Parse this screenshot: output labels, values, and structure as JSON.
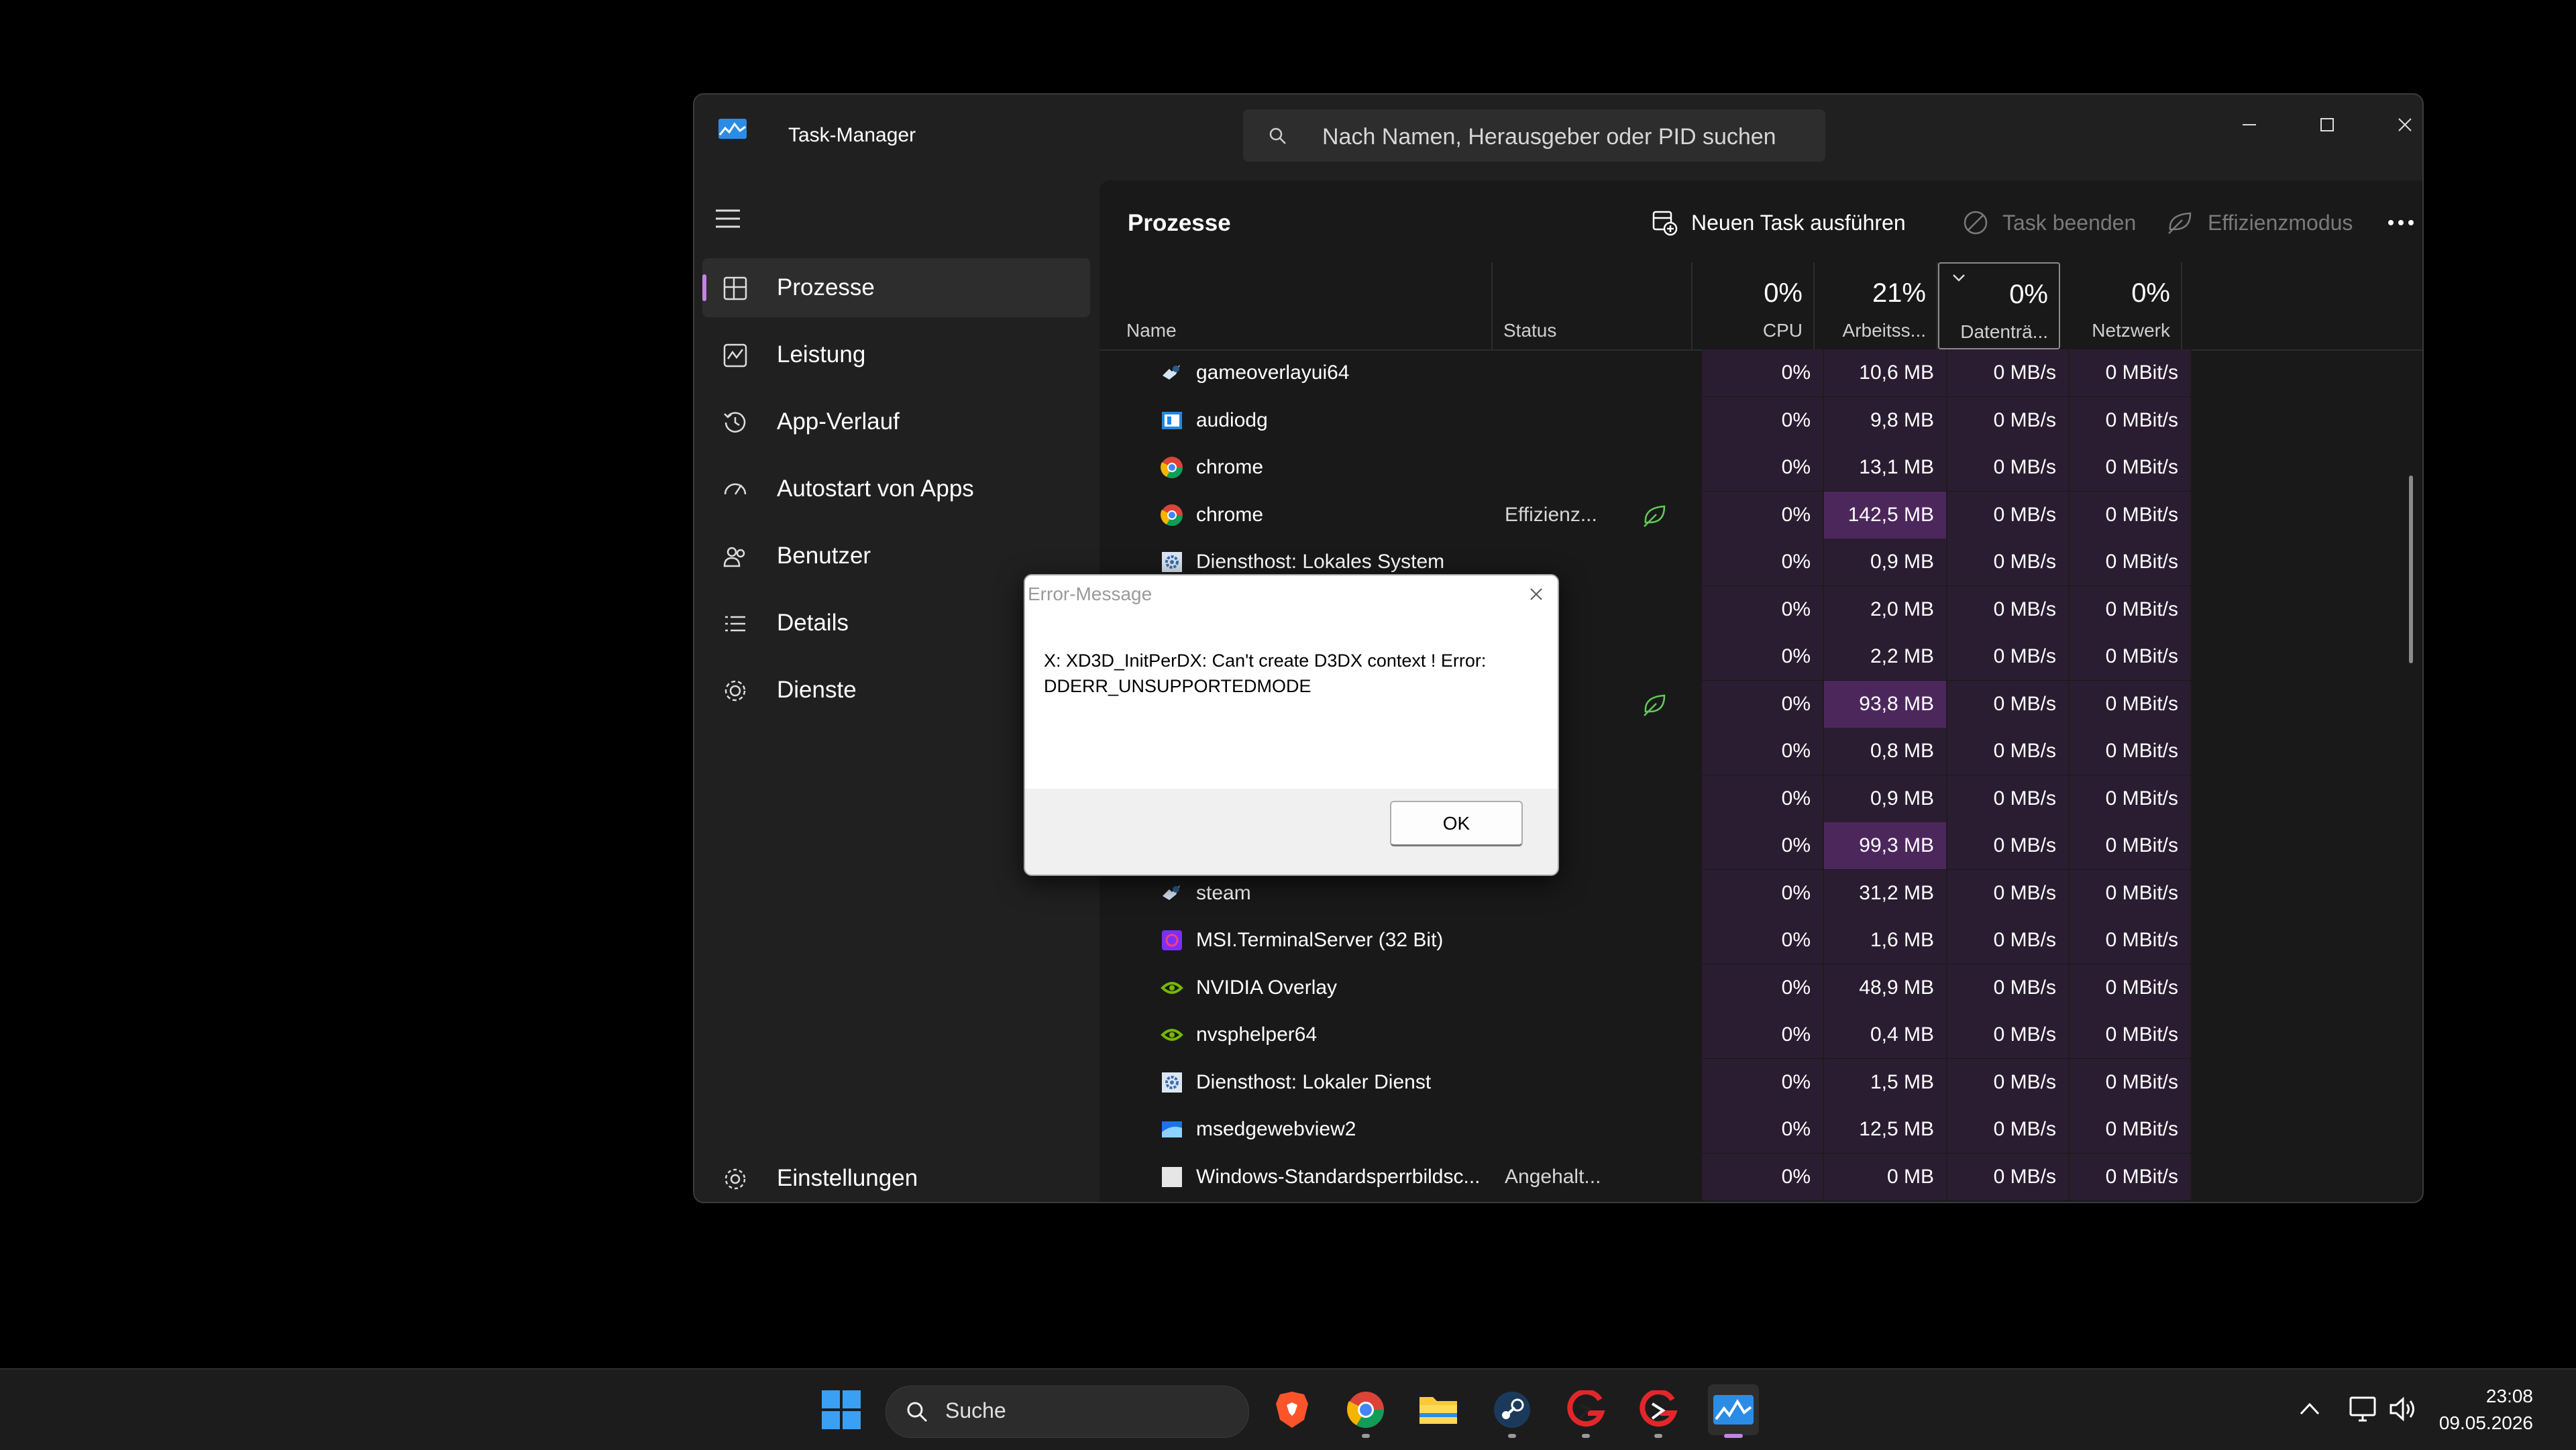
{
  "window": {
    "title": "Task-Manager"
  },
  "search": {
    "placeholder": "Nach Namen, Herausgeber oder PID suchen"
  },
  "sidebar": {
    "items": [
      {
        "label": "Prozesse",
        "icon": "processes-icon"
      },
      {
        "label": "Leistung",
        "icon": "performance-icon"
      },
      {
        "label": "App-Verlauf",
        "icon": "history-icon"
      },
      {
        "label": "Autostart von Apps",
        "icon": "startup-icon"
      },
      {
        "label": "Benutzer",
        "icon": "users-icon"
      },
      {
        "label": "Details",
        "icon": "details-icon"
      },
      {
        "label": "Dienste",
        "icon": "services-icon"
      }
    ],
    "settings": "Einstellungen"
  },
  "main": {
    "title": "Prozesse",
    "new_task": "Neuen Task ausführen",
    "end_task": "Task beenden",
    "efficiency": "Effizienzmodus"
  },
  "table": {
    "headers": {
      "name": "Name",
      "status": "Status",
      "cpu_pct": "0%",
      "cpu": "CPU",
      "mem_pct": "21%",
      "mem": "Arbeitss...",
      "disk_pct": "0%",
      "disk": "Datenträ...",
      "net_pct": "0%",
      "net": "Netzwerk"
    },
    "rows": [
      {
        "name": "gameoverlayui64",
        "status": "",
        "cpu": "0%",
        "mem": "10,6 MB",
        "disk": "0 MB/s",
        "net": "0 MBit/s",
        "icon": "steam"
      },
      {
        "name": "audiodg",
        "status": "",
        "cpu": "0%",
        "mem": "9,8 MB",
        "disk": "0 MB/s",
        "net": "0 MBit/s",
        "icon": "sys"
      },
      {
        "name": "chrome",
        "status": "",
        "cpu": "0%",
        "mem": "13,1 MB",
        "disk": "0 MB/s",
        "net": "0 MBit/s",
        "icon": "chrome"
      },
      {
        "name": "chrome",
        "status": "Effizienz...",
        "cpu": "0%",
        "mem": "142,5 MB",
        "disk": "0 MB/s",
        "net": "0 MBit/s",
        "icon": "chrome",
        "leaf": true,
        "hi": true
      },
      {
        "name": "Diensthost: Lokales System",
        "status": "",
        "cpu": "0%",
        "mem": "0,9 MB",
        "disk": "0 MB/s",
        "net": "0 MBit/s",
        "icon": "gear"
      },
      {
        "name": "",
        "status": "",
        "cpu": "0%",
        "mem": "2,0 MB",
        "disk": "0 MB/s",
        "net": "0 MBit/s",
        "icon": ""
      },
      {
        "name": "",
        "status": "",
        "cpu": "0%",
        "mem": "2,2 MB",
        "disk": "0 MB/s",
        "net": "0 MBit/s",
        "icon": ""
      },
      {
        "name": "",
        "status": "nz...",
        "cpu": "0%",
        "mem": "93,8 MB",
        "disk": "0 MB/s",
        "net": "0 MBit/s",
        "icon": "",
        "leaf": true,
        "hi": true
      },
      {
        "name": "",
        "status": "",
        "cpu": "0%",
        "mem": "0,8 MB",
        "disk": "0 MB/s",
        "net": "0 MBit/s",
        "icon": ""
      },
      {
        "name": "",
        "status": "",
        "cpu": "0%",
        "mem": "0,9 MB",
        "disk": "0 MB/s",
        "net": "0 MBit/s",
        "icon": ""
      },
      {
        "name": "",
        "status": "",
        "cpu": "0%",
        "mem": "99,3 MB",
        "disk": "0 MB/s",
        "net": "0 MBit/s",
        "icon": "",
        "hi": true
      },
      {
        "name": "steam",
        "status": "",
        "cpu": "0%",
        "mem": "31,2 MB",
        "disk": "0 MB/s",
        "net": "0 MBit/s",
        "icon": "steam"
      },
      {
        "name": "MSI.TerminalServer (32 Bit)",
        "status": "",
        "cpu": "0%",
        "mem": "1,6 MB",
        "disk": "0 MB/s",
        "net": "0 MBit/s",
        "icon": "msi"
      },
      {
        "name": "NVIDIA Overlay",
        "status": "",
        "cpu": "0%",
        "mem": "48,9 MB",
        "disk": "0 MB/s",
        "net": "0 MBit/s",
        "icon": "nvidia"
      },
      {
        "name": "nvsphelper64",
        "status": "",
        "cpu": "0%",
        "mem": "0,4 MB",
        "disk": "0 MB/s",
        "net": "0 MBit/s",
        "icon": "nvidia"
      },
      {
        "name": "Diensthost: Lokaler Dienst",
        "status": "",
        "cpu": "0%",
        "mem": "1,5 MB",
        "disk": "0 MB/s",
        "net": "0 MBit/s",
        "icon": "gear"
      },
      {
        "name": "msedgewebview2",
        "status": "",
        "cpu": "0%",
        "mem": "12,5 MB",
        "disk": "0 MB/s",
        "net": "0 MBit/s",
        "icon": "edge"
      },
      {
        "name": "Windows-Standardsperrbildsc...",
        "status": "Angehalt...",
        "cpu": "0%",
        "mem": "0 MB",
        "disk": "0 MB/s",
        "net": "0 MBit/s",
        "icon": "white"
      }
    ]
  },
  "dialog": {
    "title": "Error-Message",
    "message": "X: XD3D_InitPerDX: Can't create D3DX context ! Error: DDERR_UNSUPPORTEDMODE",
    "ok": "OK"
  },
  "taskbar": {
    "search": "Suche",
    "time": "23:08",
    "date": "09.05.2026"
  },
  "colors": {
    "accent": "#c583e6",
    "heat_low": "#2a1d31",
    "heat_high": "#4c275c"
  }
}
